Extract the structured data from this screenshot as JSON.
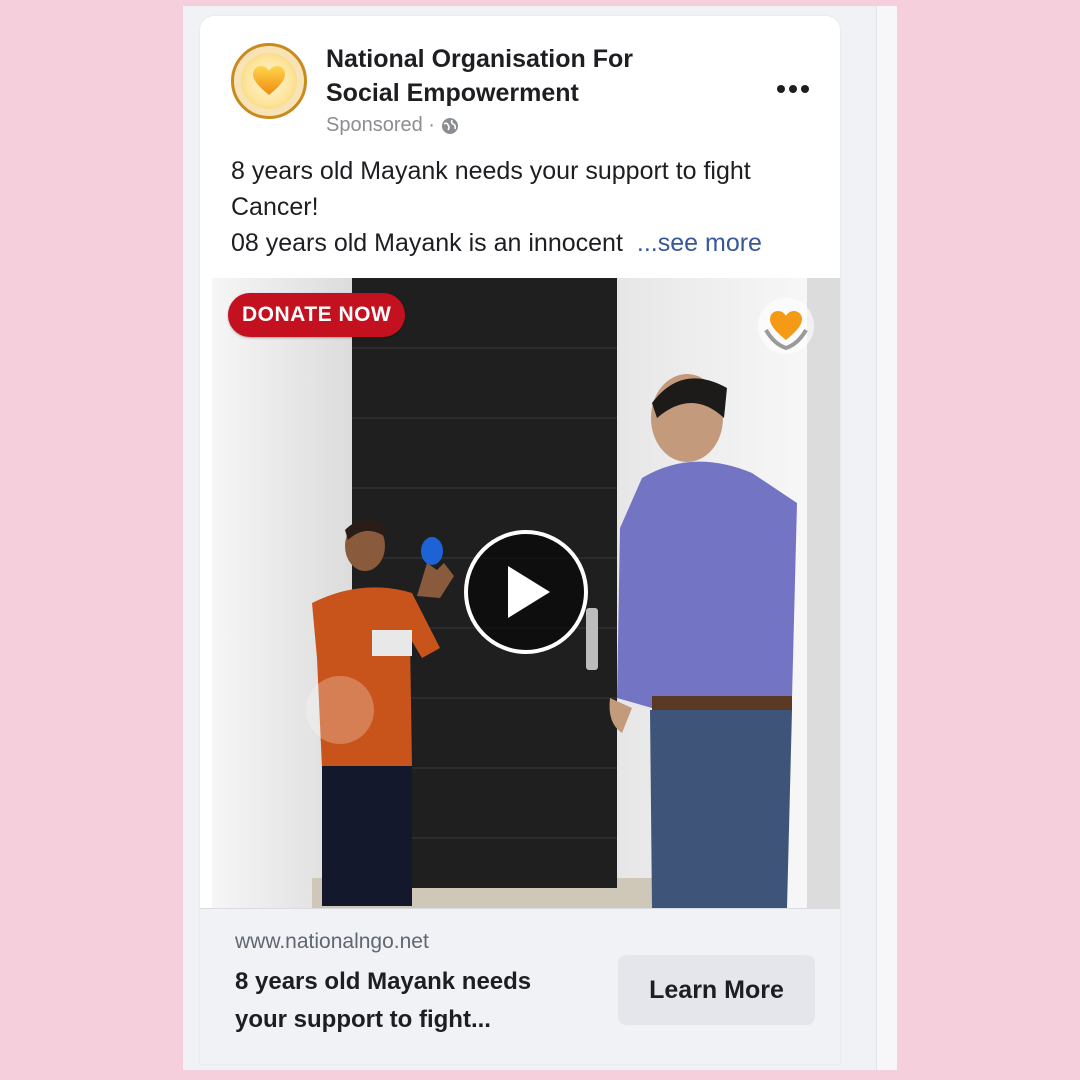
{
  "post": {
    "page_name_line1": "National Organisation For",
    "page_name_line2": "Social Empowerment",
    "sponsored_label": "Sponsored ·",
    "privacy_icon": "globe-icon",
    "more_icon": "more-horizontal-icon",
    "text_line1": "8 years old Mayank needs your support to fight",
    "text_line2": "Cancer!",
    "text_line3": "08 years old Mayank is an innocent",
    "see_more_label": "...see more"
  },
  "video": {
    "badge_label": "DONATE NOW",
    "play_icon": "play-icon",
    "watermark_icon": "heart-hands-logo-icon"
  },
  "link": {
    "domain": "www.nationalngo.net",
    "title_line1": "8 years old Mayank needs",
    "title_line2": "your support to fight...",
    "cta_label": "Learn More"
  },
  "colors": {
    "background": "#f5cfdb",
    "badge": "#c3111f",
    "see_more_link": "#385898"
  }
}
